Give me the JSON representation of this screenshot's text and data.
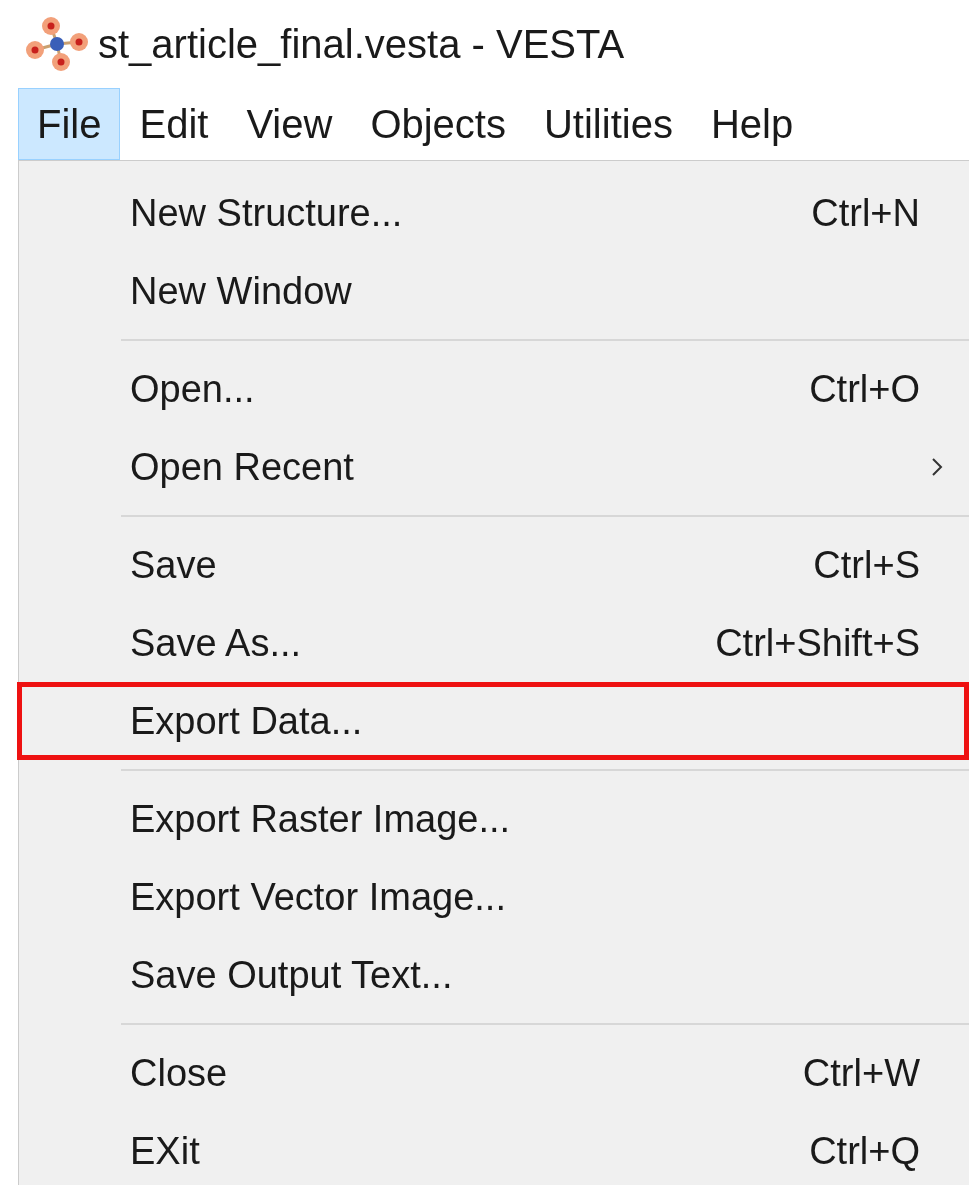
{
  "window": {
    "title": "st_article_final.vesta - VESTA"
  },
  "menu_bar": [
    {
      "label": "File",
      "selected": true
    },
    {
      "label": "Edit",
      "selected": false
    },
    {
      "label": "View",
      "selected": false
    },
    {
      "label": "Objects",
      "selected": false
    },
    {
      "label": "Utilities",
      "selected": false
    },
    {
      "label": "Help",
      "selected": false
    }
  ],
  "file_menu": {
    "groups": [
      [
        {
          "label": "New Structure...",
          "shortcut": "Ctrl+N",
          "submenu": false,
          "highlighted": false
        },
        {
          "label": "New Window",
          "submenu": false,
          "highlighted": false
        }
      ],
      [
        {
          "label": "Open...",
          "shortcut": "Ctrl+O",
          "submenu": false,
          "highlighted": false
        },
        {
          "label": "Open Recent",
          "submenu": true,
          "highlighted": false
        }
      ],
      [
        {
          "label": "Save",
          "shortcut": "Ctrl+S",
          "submenu": false,
          "highlighted": false
        },
        {
          "label": "Save As...",
          "shortcut": "Ctrl+Shift+S",
          "submenu": false,
          "highlighted": false
        },
        {
          "label": "Export Data...",
          "submenu": false,
          "highlighted": true
        }
      ],
      [
        {
          "label": "Export Raster Image...",
          "submenu": false,
          "highlighted": false
        },
        {
          "label": "Export Vector Image...",
          "submenu": false,
          "highlighted": false
        },
        {
          "label": "Save Output Text...",
          "submenu": false,
          "highlighted": false
        }
      ],
      [
        {
          "label": "Close",
          "shortcut": "Ctrl+W",
          "submenu": false,
          "highlighted": false
        },
        {
          "label": "EXit",
          "shortcut": "Ctrl+Q",
          "submenu": false,
          "highlighted": false
        }
      ]
    ]
  }
}
